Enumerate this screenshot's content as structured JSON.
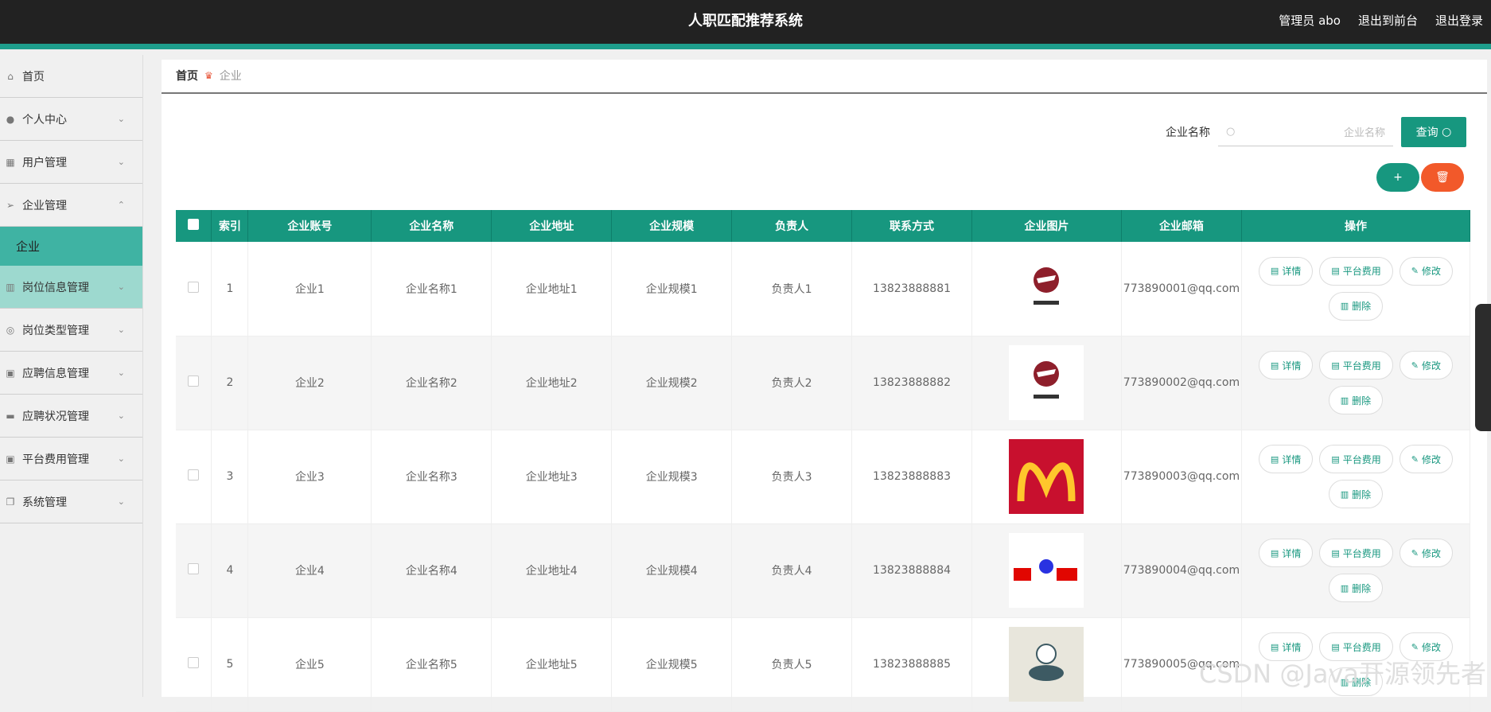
{
  "app": {
    "title": "人职匹配推荐系统",
    "admin": "管理员 abo",
    "to_front": "退出到前台",
    "logout": "退出登录"
  },
  "sidebar": {
    "items": [
      {
        "label": "首页",
        "icon": "home-icon"
      },
      {
        "label": "个人中心",
        "icon": "user-icon"
      },
      {
        "label": "用户管理",
        "icon": "grid-icon"
      },
      {
        "label": "企业管理",
        "icon": "send-icon"
      },
      {
        "label": "岗位信息管理",
        "icon": "chart-icon"
      },
      {
        "label": "岗位类型管理",
        "icon": "compass-icon"
      },
      {
        "label": "应聘信息管理",
        "icon": "clipboard-icon"
      },
      {
        "label": "应聘状况管理",
        "icon": "chat-icon"
      },
      {
        "label": "平台费用管理",
        "icon": "clipboard-icon"
      },
      {
        "label": "系统管理",
        "icon": "copy-icon"
      }
    ],
    "active_sub": "企业"
  },
  "breadcrumb": {
    "home": "首页",
    "current": "企业"
  },
  "search": {
    "label": "企业名称",
    "placeholder": "企业名称",
    "button": "查询"
  },
  "table": {
    "headers": [
      "索引",
      "企业账号",
      "企业名称",
      "企业地址",
      "企业规模",
      "负责人",
      "联系方式",
      "企业图片",
      "企业邮箱",
      "操作"
    ],
    "rows": [
      {
        "index": "1",
        "account": "企业1",
        "name": "企业名称1",
        "address": "企业地址1",
        "scale": "企业规模1",
        "leader": "负责人1",
        "phone": "13823888881",
        "logo": "tongjian-logo",
        "email": "773890001@qq.com"
      },
      {
        "index": "2",
        "account": "企业2",
        "name": "企业名称2",
        "address": "企业地址2",
        "scale": "企业规模2",
        "leader": "负责人2",
        "phone": "13823888882",
        "logo": "tongjian-logo",
        "email": "773890002@qq.com"
      },
      {
        "index": "3",
        "account": "企业3",
        "name": "企业名称3",
        "address": "企业地址3",
        "scale": "企业规模3",
        "leader": "负责人3",
        "phone": "13823888883",
        "logo": "mcdonalds-logo",
        "email": "773890003@qq.com"
      },
      {
        "index": "4",
        "account": "企业4",
        "name": "企业名称4",
        "address": "企业地址4",
        "scale": "企业规模4",
        "leader": "负责人4",
        "phone": "13823888884",
        "logo": "baidu-logo",
        "email": "773890004@qq.com"
      },
      {
        "index": "5",
        "account": "企业5",
        "name": "企业名称5",
        "address": "企业地址5",
        "scale": "企业规模5",
        "leader": "负责人5",
        "phone": "13823888885",
        "logo": "chef-fish-logo",
        "email": "773890005@qq.com"
      }
    ],
    "ops": {
      "detail": "详情",
      "fee": "平台费用",
      "edit": "修改",
      "delete": "删除"
    }
  },
  "watermark": "CSDN @Java开源领先者",
  "colors": {
    "accent": "#17977f",
    "danger": "#f2592a",
    "topbar": "#222222"
  }
}
